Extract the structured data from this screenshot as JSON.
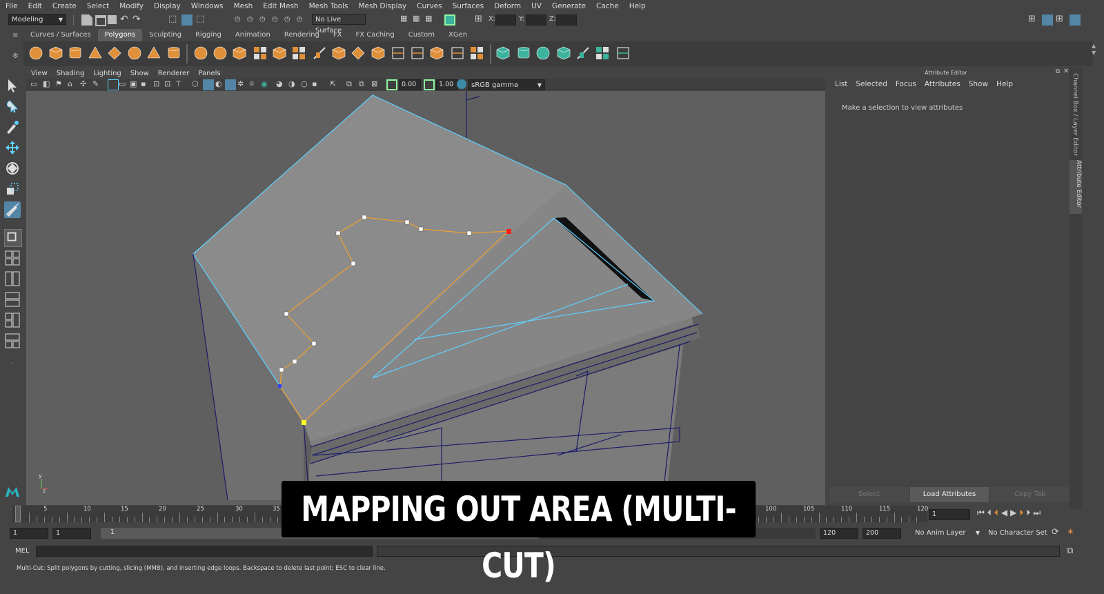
{
  "menubar": {
    "items": [
      "File",
      "Edit",
      "Create",
      "Select",
      "Modify",
      "Display",
      "Windows",
      "Mesh",
      "Edit Mesh",
      "Mesh Tools",
      "Mesh Display",
      "Curves",
      "Surfaces",
      "Deform",
      "UV",
      "Generate",
      "Cache",
      "Help"
    ]
  },
  "statusline": {
    "workspace": "Modeling",
    "live_surface": "No Live Surface",
    "x_label": "X:",
    "y_label": "Y:",
    "z_label": "Z:"
  },
  "shelf": {
    "tabs": [
      "Curves / Surfaces",
      "Polygons",
      "Sculpting",
      "Rigging",
      "Animation",
      "Rendering",
      "FX",
      "FX Caching",
      "Custom",
      "XGen"
    ],
    "active_tab": "Polygons"
  },
  "viewport": {
    "menu": [
      "View",
      "Shading",
      "Lighting",
      "Show",
      "Renderer",
      "Panels"
    ],
    "exposure": "0.00",
    "gamma": "1.00",
    "color_space": "sRGB gamma"
  },
  "attribute_editor": {
    "title": "Attribute Editor",
    "menu": [
      "List",
      "Selected",
      "Focus",
      "Attributes",
      "Show",
      "Help"
    ],
    "hint": "Make a selection to view attributes",
    "buttons": [
      "Select",
      "Load Attributes",
      "Copy Tab"
    ]
  },
  "side_tabs": {
    "channel_box": "Channel Box / Layer Editor",
    "attribute_editor": "Attribute Editor"
  },
  "timeline": {
    "ticks": [
      "1",
      "5",
      "10",
      "15",
      "20",
      "25",
      "30",
      "35",
      "100",
      "105",
      "110",
      "115",
      "120"
    ],
    "current_frame": "1"
  },
  "range": {
    "start": "1",
    "range_start": "1",
    "slider_start": "1",
    "slider_end": "120",
    "range_end": "120",
    "end": "200",
    "anim_layer": "No Anim Layer",
    "character_set": "No Character Set"
  },
  "cmdline": {
    "label": "MEL"
  },
  "helpline": {
    "text": "Multi-Cut: Split polygons by cutting, slicing (MMB), and inserting edge loops. Backspace to delete last point; ESC to clear line."
  },
  "caption": {
    "text": "MAPPING OUT AREA (MULTI-CUT)"
  },
  "colors": {
    "accent_blue": "#5285a6",
    "shelf_orange": "#e08f3a",
    "shelf_teal": "#3cb39d",
    "wire_cyan": "#5fd0ff",
    "cut_orange": "#f0a030"
  }
}
